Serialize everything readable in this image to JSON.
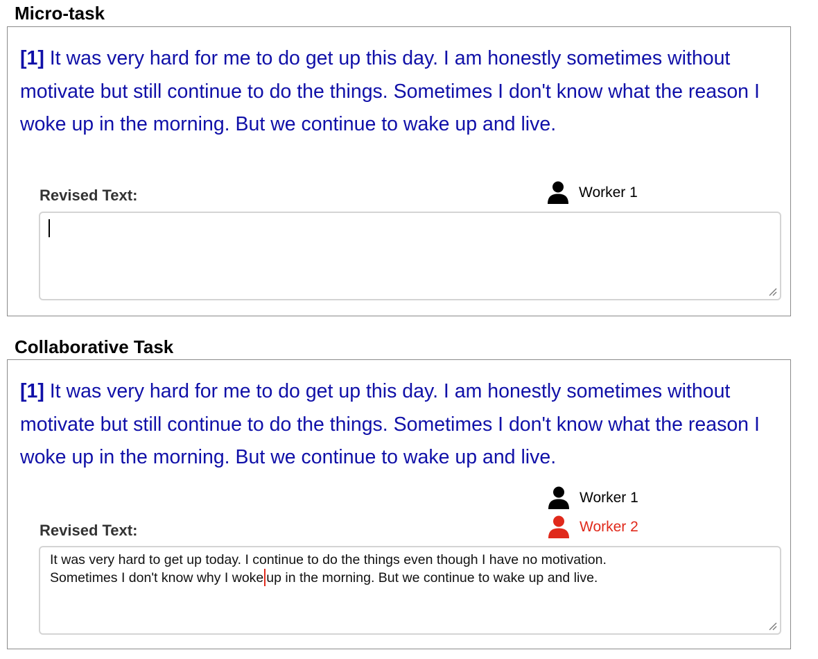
{
  "microtask": {
    "title": "Micro-task",
    "index": "[1]",
    "prompt": " It was very hard for me to do get up this day. I am honestly sometimes without motivate but still continue to do the things. Sometimes I don't know what the reason I woke up in the morning. But we continue to wake up and live.",
    "revised_label": "Revised Text:",
    "workers": [
      {
        "name": "Worker 1",
        "color": "#000000"
      }
    ],
    "revised_text": ""
  },
  "collaborative": {
    "title": "Collaborative Task",
    "index": "[1]",
    "prompt": " It was very hard for me to do get up this day. I am honestly sometimes without motivate but still continue to do the things. Sometimes I don't know what the reason I woke up in the morning. But we continue to wake up and live.",
    "revised_label": "Revised Text:",
    "workers": [
      {
        "name": "Worker 1",
        "color": "#000000"
      },
      {
        "name": "Worker 2",
        "color": "#e0291b"
      }
    ],
    "revised_text_before_cursor": "It was very hard to get up today. I continue to do the things even though I have no motivation.\nSometimes I don't know why I woke",
    "revised_text_after_cursor": "up in the morning. But we continue to wake up and live."
  },
  "colors": {
    "prompt_text": "#1010a8",
    "worker_2": "#e0291b"
  },
  "icons": {
    "worker": "person-icon",
    "resize": "resize-grip-icon"
  }
}
